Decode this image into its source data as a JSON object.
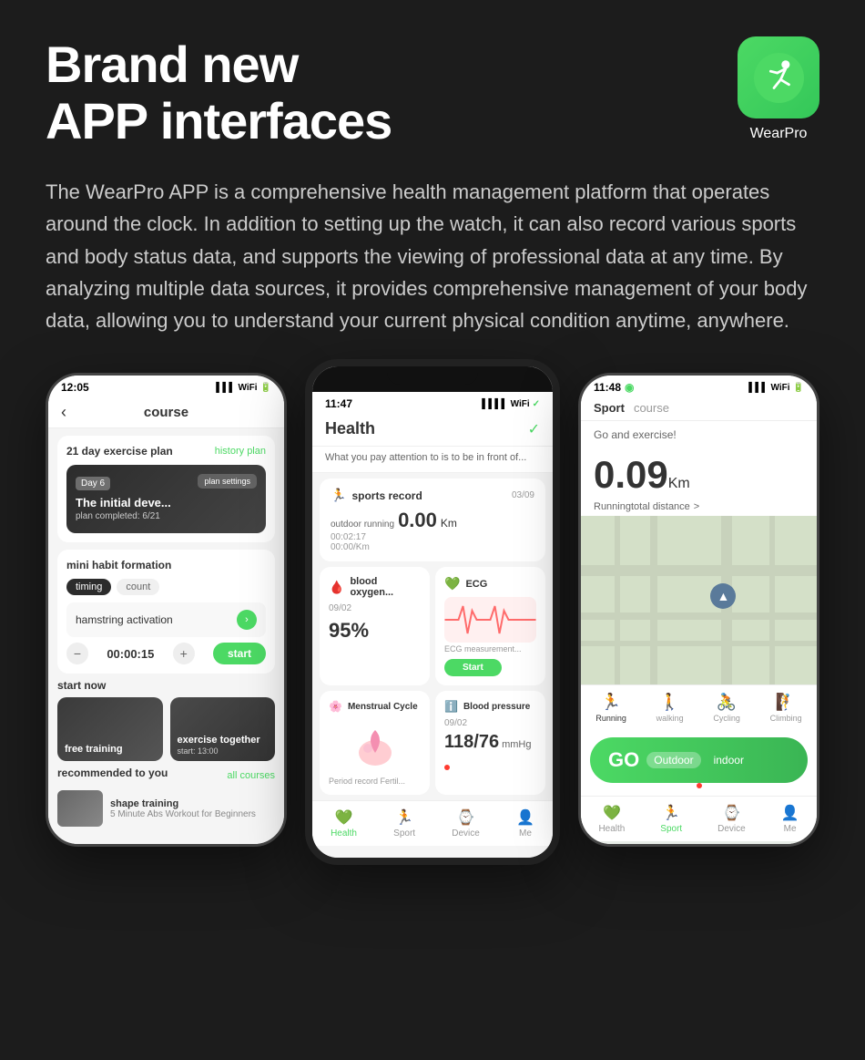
{
  "page": {
    "bg_color": "#1c1c1c"
  },
  "header": {
    "title_line1": "Brand new",
    "title_line2": "APP interfaces",
    "app_name": "WearPro",
    "app_logo_icon": "🏃"
  },
  "description": {
    "text": "The WearPro APP is a comprehensive health management platform that operates around the clock. In addition to setting up the watch, it can also record various sports and body status data, and supports the viewing of professional data at any time. By analyzing multiple data sources, it provides comprehensive management of your body data, allowing you to understand your current physical condition anytime, anywhere."
  },
  "phone_left": {
    "status_time": "12:05",
    "screen_title": "course",
    "back_icon": "‹",
    "plan_section_label": "21 day exercise plan",
    "history_plan_label": "history plan",
    "day_badge": "Day 6",
    "plan_name": "The initial deve...",
    "plan_completed": "plan completed: 6/21",
    "plan_settings_label": "plan settings",
    "mini_habit_label": "mini habit formation",
    "timing_tab": "timing",
    "count_tab": "count",
    "habit_name": "hamstring activation",
    "timer_minus": "−",
    "timer_value": "00:00:15",
    "timer_plus": "+",
    "start_btn_label": "start",
    "start_now_label": "start now",
    "free_training_label": "free training",
    "exercise_together_label": "exercise together",
    "exercise_time": "start: 13:00",
    "recommended_label": "recommended to you",
    "all_courses_label": "all courses",
    "rec_title": "shape training",
    "rec_sub": "5 Minute Abs Workout for Beginners"
  },
  "phone_middle": {
    "status_time": "11:47",
    "screen_title": "Health",
    "subtitle": "What you pay attention to is to be in front of...",
    "sports_record_label": "sports record",
    "sports_date": "03/09",
    "outdoor_label": "outdoor running",
    "distance": "0.00",
    "distance_unit": "Km",
    "time1": "00:02:17",
    "time2": "00:00/Km",
    "blood_oxy_label": "blood oxygen...",
    "blood_oxy_date": "09/02",
    "blood_oxy_value": "95%",
    "ecg_label": "ECG",
    "ecg_measurement": "ECG measurement...",
    "ecg_start_label": "Start",
    "menstrual_label": "Menstrual Cycle",
    "bp_label": "Blood pressure",
    "bp_date": "09/02",
    "bp_value": "118/76",
    "bp_unit": "mmHg",
    "period_label": "Period record Fertil...",
    "nav_health": "Health",
    "nav_sport": "Sport",
    "nav_device": "Device",
    "nav_me": "Me"
  },
  "phone_right": {
    "status_time": "11:48",
    "logo_icon": "◉",
    "sport_tab": "Sport",
    "course_tab": "course",
    "go_exercise_label": "Go and exercise!",
    "distance": "0.09",
    "distance_unit": "Km",
    "running_label": "Runningtotal distance",
    "running_arrow": ">",
    "location_icon": "▲",
    "activity_running": "Running",
    "activity_walking": "walking",
    "activity_cycling": "Cycling",
    "activity_climbing": "Climbing",
    "go_label": "GO",
    "go_outdoor": "Outdoor",
    "go_indoor": "indoor",
    "nav_health": "Health",
    "nav_sport": "Sport",
    "nav_device": "Device",
    "nav_me": "Me"
  },
  "colors": {
    "accent_green": "#4cd964",
    "bg_dark": "#1c1c1c",
    "text_white": "#ffffff",
    "text_gray": "#cccccc"
  }
}
